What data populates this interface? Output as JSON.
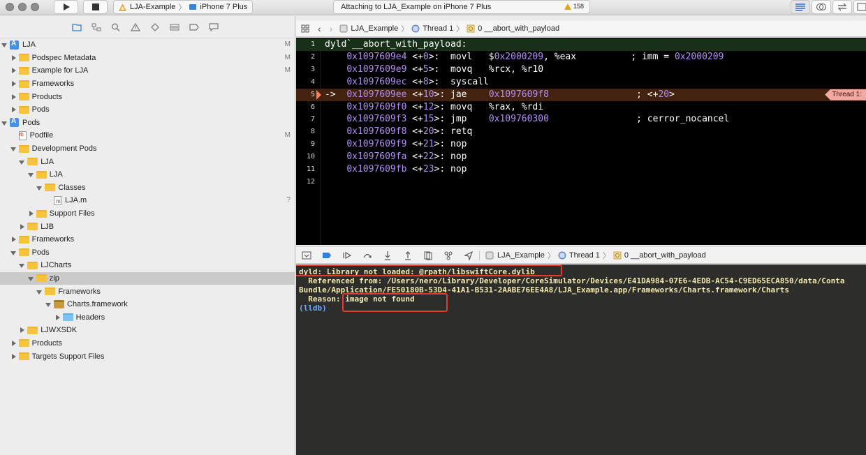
{
  "toolbar": {
    "scheme_target": "LJA-Example",
    "device": "iPhone 7 Plus",
    "activity": "Attaching to LJA_Example on iPhone 7 Plus",
    "warning_count": "158"
  },
  "navigator": {
    "tree": [
      {
        "label": "LJA",
        "badge": "M",
        "depth": 0,
        "icon": "project-icon",
        "disc": "open"
      },
      {
        "label": "Podspec Metadata",
        "badge": "M",
        "depth": 1,
        "icon": "folder-icon",
        "disc": "closed"
      },
      {
        "label": "Example for LJA",
        "badge": "M",
        "depth": 1,
        "icon": "folder-icon",
        "disc": "closed"
      },
      {
        "label": "Frameworks",
        "badge": "",
        "depth": 1,
        "icon": "folder-icon",
        "disc": "closed"
      },
      {
        "label": "Products",
        "badge": "",
        "depth": 1,
        "icon": "folder-icon",
        "disc": "closed"
      },
      {
        "label": "Pods",
        "badge": "",
        "depth": 1,
        "icon": "folder-icon",
        "disc": "closed"
      },
      {
        "label": "Pods",
        "badge": "",
        "depth": 0,
        "icon": "project-icon",
        "disc": "open"
      },
      {
        "label": "Podfile",
        "badge": "M",
        "depth": 1,
        "icon": "ruby-file-icon",
        "disc": "none"
      },
      {
        "label": "Development Pods",
        "badge": "",
        "depth": 1,
        "icon": "folder-icon",
        "disc": "open"
      },
      {
        "label": "LJA",
        "badge": "",
        "depth": 2,
        "icon": "folder-icon",
        "disc": "open"
      },
      {
        "label": "LJA",
        "badge": "",
        "depth": 3,
        "icon": "folder-icon",
        "disc": "open"
      },
      {
        "label": "Classes",
        "badge": "",
        "depth": 4,
        "icon": "folder-icon",
        "disc": "open"
      },
      {
        "label": "LJA.m",
        "badge": "?",
        "depth": 5,
        "icon": "objc-file-icon",
        "disc": "none"
      },
      {
        "label": "Support Files",
        "badge": "",
        "depth": 3,
        "icon": "folder-icon",
        "disc": "closed"
      },
      {
        "label": "LJB",
        "badge": "",
        "depth": 2,
        "icon": "folder-icon",
        "disc": "closed"
      },
      {
        "label": "Frameworks",
        "badge": "",
        "depth": 1,
        "icon": "folder-icon",
        "disc": "closed"
      },
      {
        "label": "Pods",
        "badge": "",
        "depth": 1,
        "icon": "folder-icon",
        "disc": "open"
      },
      {
        "label": "LJCharts",
        "badge": "",
        "depth": 2,
        "icon": "folder-icon",
        "disc": "open"
      },
      {
        "label": "zip",
        "badge": "",
        "depth": 3,
        "icon": "folder-icon",
        "disc": "open",
        "selected": true
      },
      {
        "label": "Frameworks",
        "badge": "",
        "depth": 4,
        "icon": "folder-icon",
        "disc": "open"
      },
      {
        "label": "Charts.framework",
        "badge": "",
        "depth": 5,
        "icon": "framework-icon",
        "disc": "open"
      },
      {
        "label": "Headers",
        "badge": "",
        "depth": 6,
        "icon": "blue-folder-icon",
        "disc": "closed"
      },
      {
        "label": "LJWXSDK",
        "badge": "",
        "depth": 2,
        "icon": "folder-icon",
        "disc": "closed"
      },
      {
        "label": "Products",
        "badge": "",
        "depth": 1,
        "icon": "folder-icon",
        "disc": "closed"
      },
      {
        "label": "Targets Support Files",
        "badge": "",
        "depth": 1,
        "icon": "folder-icon",
        "disc": "closed"
      }
    ]
  },
  "jumpbar": {
    "target": "LJA_Example",
    "thread": "Thread 1",
    "frame": "0 __abort_with_payload"
  },
  "editor": {
    "lines": [
      {
        "n": "1",
        "parts": [
          [
            "t",
            "dyld`__abort_with_payload:"
          ]
        ]
      },
      {
        "n": "2",
        "parts": [
          [
            "t",
            "    "
          ],
          [
            "a",
            "0x1097609e4"
          ],
          [
            "t",
            " <+"
          ],
          [
            "n",
            "0"
          ],
          [
            "t",
            ">:  movl   $"
          ],
          [
            "n",
            "0x2000209"
          ],
          [
            "t",
            ", %eax          ; imm = "
          ],
          [
            "n",
            "0x2000209"
          ]
        ]
      },
      {
        "n": "3",
        "parts": [
          [
            "t",
            "    "
          ],
          [
            "a",
            "0x1097609e9"
          ],
          [
            "t",
            " <+"
          ],
          [
            "n",
            "5"
          ],
          [
            "t",
            ">:  movq   %rcx, %r10"
          ]
        ]
      },
      {
        "n": "4",
        "parts": [
          [
            "t",
            "    "
          ],
          [
            "a",
            "0x1097609ec"
          ],
          [
            "t",
            " <+"
          ],
          [
            "n",
            "8"
          ],
          [
            "t",
            ">:  syscall"
          ]
        ]
      },
      {
        "n": "5",
        "parts": [
          [
            "t",
            "->  "
          ],
          [
            "a",
            "0x1097609ee"
          ],
          [
            "t",
            " <+"
          ],
          [
            "n",
            "10"
          ],
          [
            "t",
            ">: jae    "
          ],
          [
            "n",
            "0x1097609f8"
          ],
          [
            "t",
            "                ; <+"
          ],
          [
            "n",
            "20"
          ],
          [
            "t",
            ">"
          ]
        ]
      },
      {
        "n": "6",
        "parts": [
          [
            "t",
            "    "
          ],
          [
            "a",
            "0x1097609f0"
          ],
          [
            "t",
            " <+"
          ],
          [
            "n",
            "12"
          ],
          [
            "t",
            ">: movq   %rax, %rdi"
          ]
        ]
      },
      {
        "n": "7",
        "parts": [
          [
            "t",
            "    "
          ],
          [
            "a",
            "0x1097609f3"
          ],
          [
            "t",
            " <+"
          ],
          [
            "n",
            "15"
          ],
          [
            "t",
            ">: jmp    "
          ],
          [
            "n",
            "0x109760300"
          ],
          [
            "t",
            "                ; cerror_nocancel"
          ]
        ]
      },
      {
        "n": "8",
        "parts": [
          [
            "t",
            "    "
          ],
          [
            "a",
            "0x1097609f8"
          ],
          [
            "t",
            " <+"
          ],
          [
            "n",
            "20"
          ],
          [
            "t",
            ">: retq"
          ]
        ]
      },
      {
        "n": "9",
        "parts": [
          [
            "t",
            "    "
          ],
          [
            "a",
            "0x1097609f9"
          ],
          [
            "t",
            " <+"
          ],
          [
            "n",
            "21"
          ],
          [
            "t",
            ">: nop"
          ]
        ]
      },
      {
        "n": "10",
        "parts": [
          [
            "t",
            "    "
          ],
          [
            "a",
            "0x1097609fa"
          ],
          [
            "t",
            " <+"
          ],
          [
            "n",
            "22"
          ],
          [
            "t",
            ">: nop"
          ]
        ]
      },
      {
        "n": "11",
        "parts": [
          [
            "t",
            "    "
          ],
          [
            "a",
            "0x1097609fb"
          ],
          [
            "t",
            " <+"
          ],
          [
            "n",
            "23"
          ],
          [
            "t",
            ">: nop"
          ]
        ]
      },
      {
        "n": "12",
        "parts": []
      }
    ],
    "current_line": 5,
    "thread_tag": "Thread 1:"
  },
  "debugbar": {
    "target": "LJA_Example",
    "thread": "Thread 1",
    "frame": "0 __abort_with_payload"
  },
  "console": {
    "line1": "dyld: Library not loaded: @rpath/libswiftCore.dylib",
    "line2": "  Referenced from: /Users/nero/Library/Developer/CoreSimulator/Devices/E41DA984-07E6-4EDB-AC54-C9ED65ECA850/data/Conta",
    "line3": "Bundle/Application/FE50180B-53D4-41A1-B531-2AABE76EE4A8/LJA_Example.app/Frameworks/Charts.framework/Charts",
    "line4_label": "  Reason: ",
    "line4_value": "image not found",
    "prompt": "(lldb)"
  },
  "colors": {
    "highlight_box": "#e8392b",
    "pc_line": "#43220f",
    "address": "#b38ef5",
    "console_text": "#f2e9b0"
  }
}
